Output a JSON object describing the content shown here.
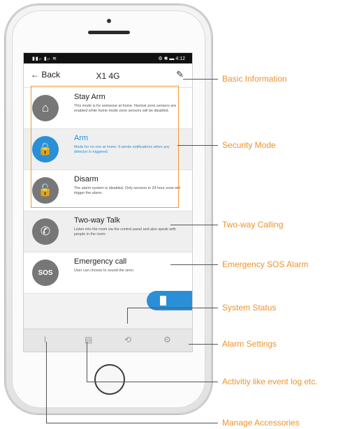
{
  "phone": {
    "status_left": "▮▮ᵢₗ ▮ᵢₗ ≋",
    "status_right": "⚙ ✱ ▬ 4:12",
    "nav": {
      "back_label": "← Back",
      "title": "X1 4G"
    },
    "modes": [
      {
        "name": "Stay Arm",
        "desc": "This mode is for someone at home. Normal zone sensors are enabled while home mode zone sensors will be disabled.",
        "icon": "⌂"
      },
      {
        "name": "Arm",
        "desc": "Mode for no one at home. It sends notifications when any detector is triggered.",
        "icon": "🔒"
      },
      {
        "name": "Disarm",
        "desc": "The alarm system is disabled. Only sensors in 24 hour zone will trigger the alarm.",
        "icon": "🔓"
      }
    ],
    "talk": {
      "name": "Two-way Talk",
      "desc": "Listen into the room via the control panel and also speak with people in the room.",
      "icon": "✆"
    },
    "sos": {
      "name": "Emergency call",
      "desc": "User can choose to sound the siren.",
      "icon": "SOS"
    },
    "tabs": [
      "ǀ",
      "▤",
      "⟲",
      "⚙"
    ]
  },
  "callouts": {
    "basic_info": "Basic Information",
    "security_mode": "Security Mode",
    "two_way_calling": "Two-way Calling",
    "emergency_sos": "Emergency SOS Alarm",
    "system_status": "System Status",
    "alarm_settings": "Alarm Settings",
    "activity": "Activitiy like event log etc.",
    "manage_accessories": "Manage Accessories"
  },
  "colors": {
    "accent": "#2a8fd6",
    "callout": "#f0922a"
  }
}
